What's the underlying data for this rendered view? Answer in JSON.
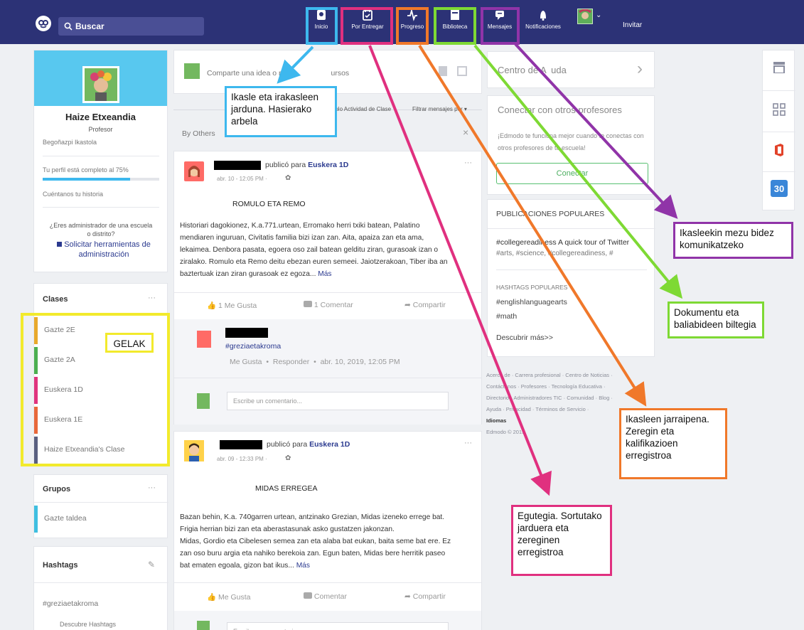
{
  "topbar": {
    "search_placeholder": "Buscar",
    "nav": {
      "inicio": "Inicio",
      "por_entregar": "Por Entregar",
      "progreso": "Progreso",
      "biblioteca": "Biblioteca",
      "mensajes": "Mensajes",
      "notificaciones": "Notificaciones"
    },
    "invitar": "Invitar"
  },
  "profile": {
    "name": "Haize Etxeandia",
    "role": "Profesor",
    "school": "Begoñazpi Ikastola",
    "completion_text": "Tu perfil está completo al 75%",
    "completion": 0.75,
    "story_link": "Cuéntanos tu historia",
    "admin_question": "¿Eres administrador de una escuela o distrito?",
    "admin_link": "Solicitar herramientas de administración"
  },
  "classes": {
    "title": "Clases",
    "items": [
      {
        "label": "Gazte 2E",
        "color": "#e8a92b"
      },
      {
        "label": "Gazte 2A",
        "color": "#4caf50"
      },
      {
        "label": "Euskera 1D",
        "color": "#e0347e"
      },
      {
        "label": "Euskera 1E",
        "color": "#e8683a"
      },
      {
        "label": "Haize Etxeandia's Clase",
        "color": "#5a6080"
      }
    ]
  },
  "groups": {
    "title": "Grupos",
    "items": [
      {
        "label": "Gazte taldea",
        "color": "#3fbfe0"
      }
    ]
  },
  "hashtags": {
    "title": "Hashtags",
    "items": [
      "#greziaetakroma"
    ],
    "discover": "Descubre Hashtags"
  },
  "composer": {
    "placeholder_a": "Comparte una idea o r",
    "placeholder_b": "ursos",
    "filter_toggle": "Solo Actividad de Clase",
    "filter_select": "Filtrar mensajes por",
    "by_others": "By Others"
  },
  "posts": [
    {
      "action": "publicó para",
      "target": "Euskera 1D",
      "time": "abr. 10 - 12:05 PM ·",
      "title": "ROMULO ETA REMO",
      "lines": [
        "Historiari dagokionez, K.a.771.urtean, Erromako herri txiki batean, Palatino",
        "mendiaren inguruan, Civitatis familia bizi izan zan. Aita, apaiza zan eta ama,",
        "lekaimea. Denbora pasata, egoera oso zail batean gelditu ziran, gurasoak izan o",
        "ziralako. Romulo eta Remo deitu ebezan euren semeei. Jaiotzerakoan, Tiber iba an",
        "baztertuak izan ziran gurasoak ez egoza..."
      ],
      "more": "Más",
      "like": "1 Me Gusta",
      "comment": "1 Comentar",
      "share": "Compartir",
      "reply_tag": "#greziaetakroma",
      "reply_meta": "Me Gusta  •  Responder  •  abr. 10, 2019, 12:05 PM",
      "comment_placeholder": "Escribe un comentario..."
    },
    {
      "action": "publicó para",
      "target": "Euskera 1D",
      "time": "abr. 09 - 12:33 PM ·",
      "title": "MIDAS ERREGEA",
      "lines": [
        "Bazan behin, K.a. 740garren urtean, antzinako Grezian, Midas izeneko errege bat.",
        "Frigia herrian bizi zan eta aberastasunak asko gustatzen jakonzan.",
        "Midas, Gordio eta Cibelesen semea zan eta alaba bat eukan, baita seme bat ere. Ez",
        "zan oso buru argia eta nahiko berekoia zan. Egun baten, Midas bere herritik paseo",
        "bat ematen egoala, gizon bat ikus..."
      ],
      "more": "Más",
      "like": "Me Gusta",
      "comment": "Comentar",
      "share": "Compartir",
      "comment_placeholder": "Escribe un comentario..."
    }
  ],
  "right": {
    "help": "Centro de A  uda",
    "connect_title": "Conectar con otros profesores",
    "connect_text": "¡Edmodo te funciona mejor cuando te conectas con otros profesores de tu escuela!",
    "connect_btn": "Conectar",
    "popular_title": "PUBLICACIONES POPULARES",
    "popular_item": "#collegereadiness A quick tour of Twitter",
    "popular_tags": "#arts, #science, #collegereadiness, #",
    "hashtags_title": "HASHTAGS POPULARES",
    "hashtags": [
      "#englishlanguagearts",
      "#math"
    ],
    "discover": "Descubrir más>>",
    "footer_lines": [
      "Acerca de · Carrera profesional · Centro de Noticias ·",
      "Contáctanos · Profesores · Tecnología Educativa ·",
      "Directorio · Administradores TIC · Comunidad · Blog ·",
      "Ayuda · Privacidad · Términos de Servicio ·"
    ],
    "idiomas": "Idiomas",
    "copyright": "Edmodo © 2019"
  },
  "annotations": {
    "inicio": "Ikasle eta irakasleen jarduna. Hasierako arbela",
    "gelak": "GELAK",
    "mensajes": "Ikasleekin mezu bidez komunikatzeko",
    "biblioteca": "Dokumentu eta baliabideen biltegia",
    "progreso": "Ikasleen jarraipena. Zeregin eta kalifikazioen erregistroa",
    "por_entregar": "Egutegia. Sortutako jarduera eta zereginen erregistroa"
  },
  "colors": {
    "topbar": "#2c3276",
    "cyan": "#3db8ee",
    "pink": "#e0307f",
    "orange": "#f0782a",
    "green": "#7ed934",
    "purple": "#9034a8",
    "yellow": "#f2ea2c"
  },
  "icons": [
    "edmodo-logo-icon",
    "search-icon",
    "home-icon",
    "calendar-icon",
    "pulse-icon",
    "library-icon",
    "chat-icon",
    "bell-icon",
    "chevron-down-icon",
    "store-icon",
    "apps-icon",
    "office-icon",
    "calendar-30-icon",
    "chevron-right-icon",
    "like-icon",
    "comment-icon",
    "share-icon",
    "more-icon",
    "pencil-icon",
    "close-icon",
    "toggle-icon"
  ]
}
